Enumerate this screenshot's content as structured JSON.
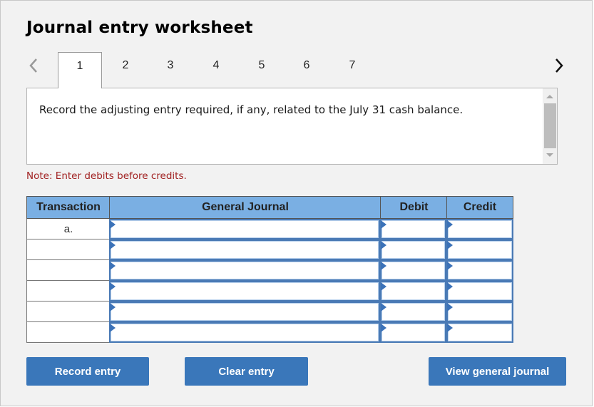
{
  "title": "Journal entry worksheet",
  "tabs": {
    "prev_icon": "chevron-left-icon",
    "next_icon": "chevron-right-icon",
    "items": [
      {
        "label": "1",
        "active": true
      },
      {
        "label": "2",
        "active": false
      },
      {
        "label": "3",
        "active": false
      },
      {
        "label": "4",
        "active": false
      },
      {
        "label": "5",
        "active": false
      },
      {
        "label": "6",
        "active": false
      },
      {
        "label": "7",
        "active": false
      }
    ]
  },
  "question": {
    "text": "Record the adjusting entry required, if any, related to the July 31 cash balance."
  },
  "note": "Note: Enter debits before credits.",
  "journal": {
    "columns": [
      "Transaction",
      "General Journal",
      "Debit",
      "Credit"
    ],
    "rows": [
      {
        "transaction": "a.",
        "account": "",
        "debit": "",
        "credit": ""
      },
      {
        "transaction": "",
        "account": "",
        "debit": "",
        "credit": ""
      },
      {
        "transaction": "",
        "account": "",
        "debit": "",
        "credit": ""
      },
      {
        "transaction": "",
        "account": "",
        "debit": "",
        "credit": ""
      },
      {
        "transaction": "",
        "account": "",
        "debit": "",
        "credit": ""
      },
      {
        "transaction": "",
        "account": "",
        "debit": "",
        "credit": ""
      }
    ]
  },
  "buttons": {
    "record": "Record entry",
    "clear": "Clear entry",
    "view": "View general journal"
  },
  "colors": {
    "header_bg": "#7aafe3",
    "button_bg": "#3a77ba",
    "note_text": "#a12222",
    "input_border": "#4a7ab5"
  }
}
